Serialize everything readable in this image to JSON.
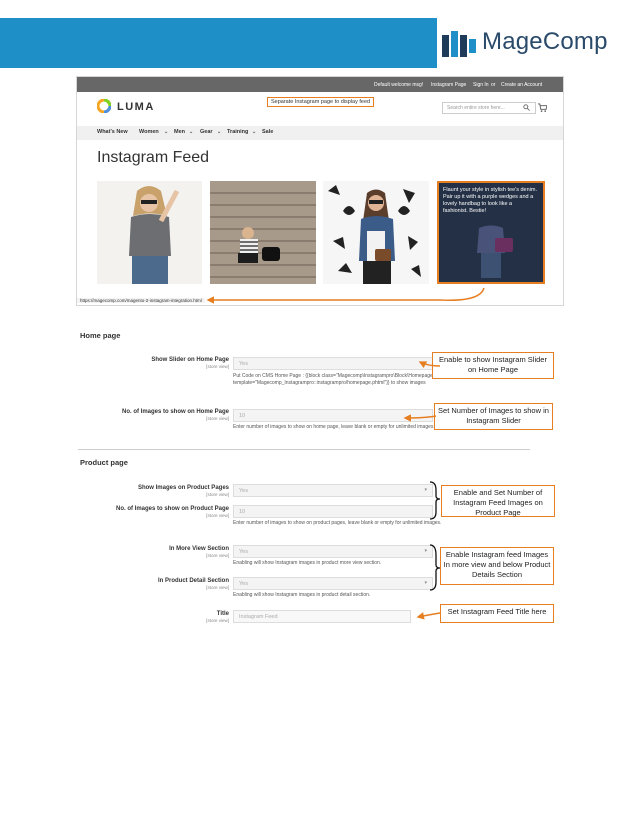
{
  "brand": {
    "name": "MageComp"
  },
  "store": {
    "topbar": {
      "welcome": "Default welcome msg!",
      "instagram_link": "Instagram Page",
      "sign_in": "Sign In",
      "or": "or",
      "create_account": "Create an Account"
    },
    "logo_text": "LUMA",
    "separate_note": "Separate Instagram page to display feed",
    "search_placeholder": "Search entire store here...",
    "nav": [
      "What's New",
      "Women",
      "Men",
      "Gear",
      "Training",
      "Sale"
    ],
    "page_title": "Instagram Feed",
    "overlay_caption": "Flaunt your style in stylish tee's denim. Pair up it with a purple wedges and a lovely handbag to look like a fashionist. Bestie!",
    "status_url": "https://magecomp.com/magento-2-instagram-integration.html",
    "colors": {
      "accent": "#e67e22",
      "band": "#1f8fc7",
      "topbar": "#676767"
    }
  },
  "config": {
    "home_section": "Home page",
    "product_section": "Product page",
    "store_view": "[store view]",
    "fields": {
      "show_slider": {
        "label": "Show Slider on Home Page",
        "value": "Yes",
        "note": "Put Code on CMS Home Page : {{block class=\"Magecomp\\Instagrampro\\Block\\Homepage\" template=\"Magecomp_Instagrampro::instagrampro/homepage.phtml\"}} to show images"
      },
      "home_count": {
        "label": "No. of Images to show on Home Page",
        "value": "10",
        "note": "Enter number of images to show on home page, leave blank or empty for unlimited images."
      },
      "show_product": {
        "label": "Show Images on Product Pages",
        "value": "Yes"
      },
      "product_count": {
        "label": "No. of Images to show on Product Page",
        "value": "10",
        "note": "Enter number of images to show on product pages, leave blank or empty for unlimited images."
      },
      "more_view": {
        "label": "In More View Section",
        "value": "Yes",
        "note": "Enabling will show Instagram images in product more view section."
      },
      "detail_section": {
        "label": "In Product Detail Section",
        "value": "Yes",
        "note": "Enabling will show Instagram images in product detail section."
      },
      "title": {
        "label": "Title",
        "placeholder": "Instagram Feed"
      }
    },
    "callouts": {
      "slider": "Enable to show Instagram Slider on Home Page",
      "home_count": "Set Number of Images to show in Instagram Slider",
      "product": "Enable and Set Number of Instagram Feed Images on Product Page",
      "more_view": "Enable Instagram feed Images In more view and below Product Details Section",
      "title": "Set Instagram Feed Title here"
    }
  }
}
